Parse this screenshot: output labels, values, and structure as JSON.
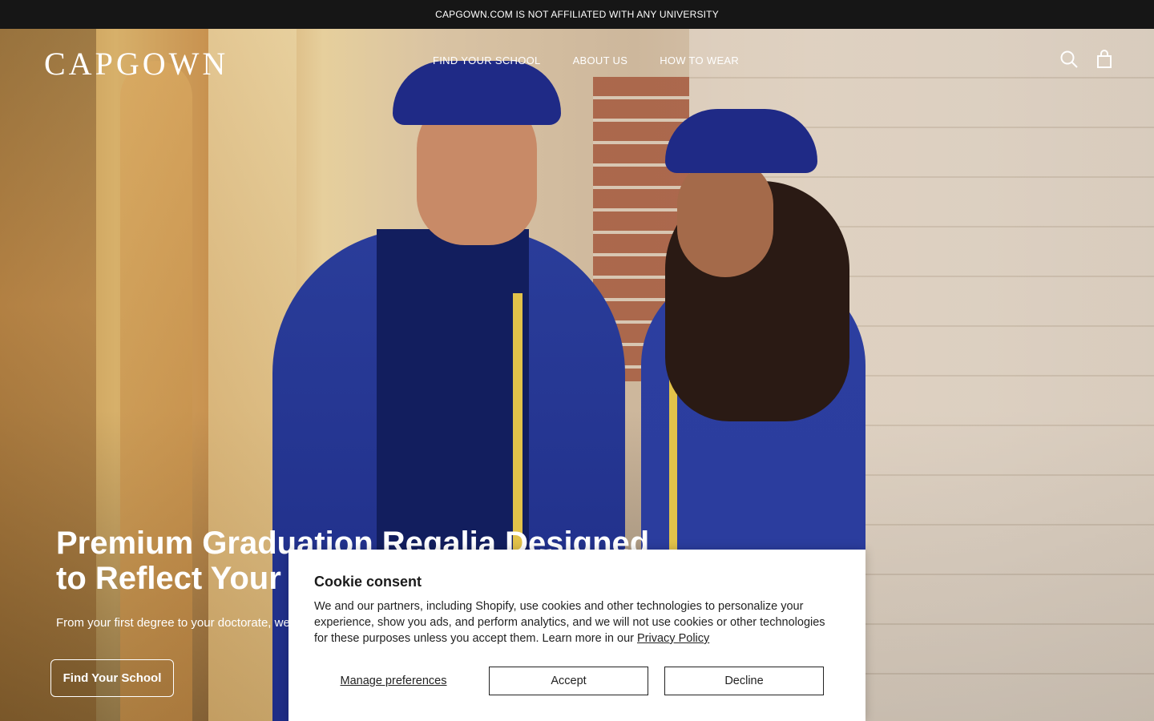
{
  "announcement": {
    "text": "CAPGOWN.COM IS NOT AFFILIATED WITH ANY UNIVERSITY"
  },
  "header": {
    "logo": "CAPGOWN",
    "nav": [
      "FIND YOUR SCHOOL",
      "ABOUT US",
      "HOW TO WEAR"
    ],
    "icons": [
      "search-icon",
      "cart-icon"
    ]
  },
  "hero": {
    "title_line1": "Premium Graduation Regalia Designed",
    "title_line2": "to Reflect Your Achievement",
    "subtitle": "From your first degree to your doctorate, we offer regalia made to honor every milestone.",
    "button": "Find Your School"
  },
  "cookie": {
    "title": "Cookie consent",
    "text": "We and our partners, including Shopify, use cookies and other technologies to personalize your experience, show you ads, and perform analytics, and we will not use cookies or other technologies for these purposes unless you accept them. Learn more in our",
    "link": "Privacy Policy",
    "manage": "Manage preferences",
    "accept": "Accept",
    "decline": "Decline"
  },
  "colors": {
    "announcement_bg": "#161616",
    "robe": "#2a3d9a",
    "trim": "#e2c24a"
  }
}
